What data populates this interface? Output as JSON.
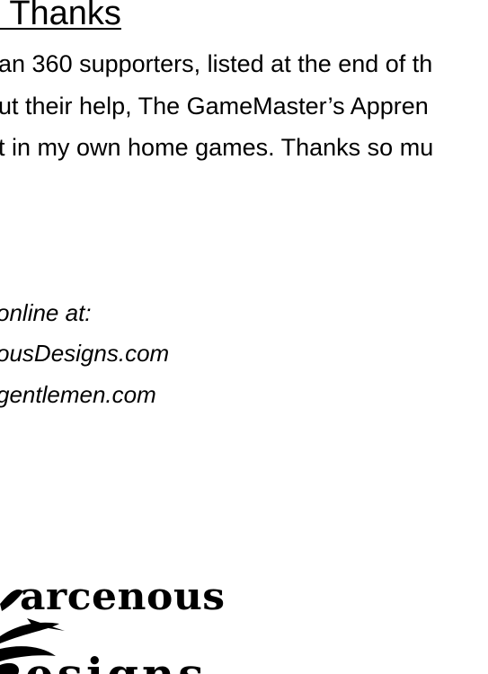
{
  "heading": {
    "text": "l Thanks"
  },
  "paragraph": {
    "lines": [
      "an 360 supporters, listed at the end of th",
      "ut their help, The GameMaster’s Appren",
      "t in my own home games. Thanks so mu"
    ]
  },
  "online": {
    "lines": [
      "online at:",
      "ousDesigns.com",
      "gentlemen.com"
    ]
  },
  "logo": {
    "word1": "arcenous",
    "word2": "esigns"
  }
}
